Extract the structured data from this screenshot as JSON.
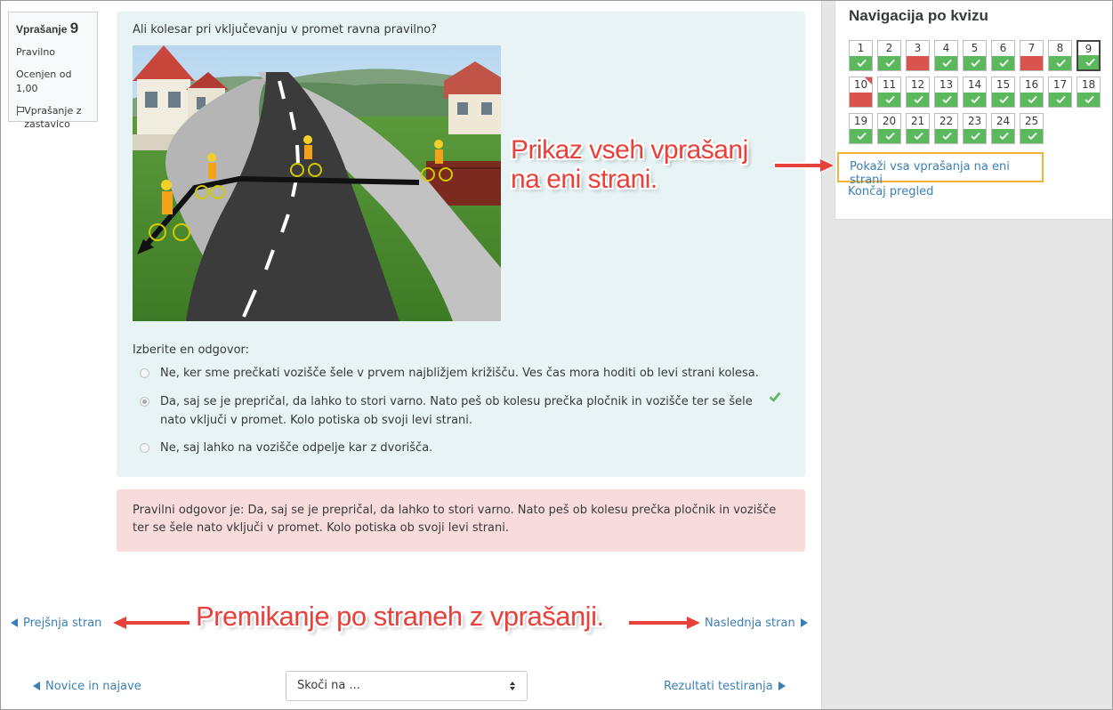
{
  "question_info": {
    "label": "Vprašanje",
    "number": "9",
    "state": "Pravilno",
    "grade": "Ocenjen od 1,00",
    "flag_label": "Vprašanje z zastavico"
  },
  "question": {
    "text": "Ali kolesar pri vključevanju v promet ravna pravilno?",
    "prompt": "Izberite en odgovor:",
    "answers": [
      {
        "text": "Ne, ker sme prečkati vozišče šele v prvem najbližjem križišču. Ves čas mora hoditi ob levi strani kolesa.",
        "selected": false
      },
      {
        "text": "Da, saj se je prepričal, da lahko to stori varno. Nato peš ob kolesu prečka pločnik in vozišče ter se šele nato vključi v promet. Kolo potiska ob svoji levi strani.",
        "selected": true,
        "correct": true
      },
      {
        "text": "Ne, saj lahko na vozišče odpelje kar z dvorišča.",
        "selected": false
      }
    ],
    "check_icon": "checkmark-icon"
  },
  "feedback": {
    "text": "Pravilni odgovor je: Da, saj se je prepričal, da lahko to stori varno. Nato peš ob kolesu prečka pločnik in vozišče ter se šele nato vključi v promet. Kolo potiska ob svoji levi strani."
  },
  "page_nav": {
    "prev": "Prejšnja stran",
    "next": "Naslednja stran"
  },
  "footer": {
    "prev_activity": "Novice in najave",
    "jump_placeholder": "Skoči na ...",
    "next_activity": "Rezultati testiranja"
  },
  "quiz_nav": {
    "title": "Navigacija po kvizu",
    "questions": [
      {
        "n": "1",
        "status": "ok"
      },
      {
        "n": "2",
        "status": "ok"
      },
      {
        "n": "3",
        "status": "bad"
      },
      {
        "n": "4",
        "status": "ok"
      },
      {
        "n": "5",
        "status": "ok"
      },
      {
        "n": "6",
        "status": "ok"
      },
      {
        "n": "7",
        "status": "bad"
      },
      {
        "n": "8",
        "status": "ok"
      },
      {
        "n": "9",
        "status": "ok",
        "current": true
      },
      {
        "n": "10",
        "status": "bad",
        "flagged": true
      },
      {
        "n": "11",
        "status": "ok"
      },
      {
        "n": "12",
        "status": "ok"
      },
      {
        "n": "13",
        "status": "ok"
      },
      {
        "n": "14",
        "status": "ok"
      },
      {
        "n": "15",
        "status": "ok"
      },
      {
        "n": "16",
        "status": "ok"
      },
      {
        "n": "17",
        "status": "ok"
      },
      {
        "n": "18",
        "status": "ok"
      },
      {
        "n": "19",
        "status": "ok"
      },
      {
        "n": "20",
        "status": "ok"
      },
      {
        "n": "21",
        "status": "ok"
      },
      {
        "n": "22",
        "status": "ok"
      },
      {
        "n": "23",
        "status": "ok"
      },
      {
        "n": "24",
        "status": "ok"
      },
      {
        "n": "25",
        "status": "ok"
      }
    ],
    "show_all": "Pokaži vsa vprašanja na eni strani",
    "finish": "Končaj pregled"
  },
  "annotations": {
    "show_all_line1": "Prikaz vseh vprašanj",
    "show_all_line2": "na eni strani.",
    "paging": "Premikanje po straneh z vprašanji."
  },
  "colors": {
    "link": "#3a7fb6",
    "correct": "#5cb85c",
    "incorrect": "#d9534f",
    "annotation": "#e8403a",
    "highlight": "#f0b33c"
  }
}
